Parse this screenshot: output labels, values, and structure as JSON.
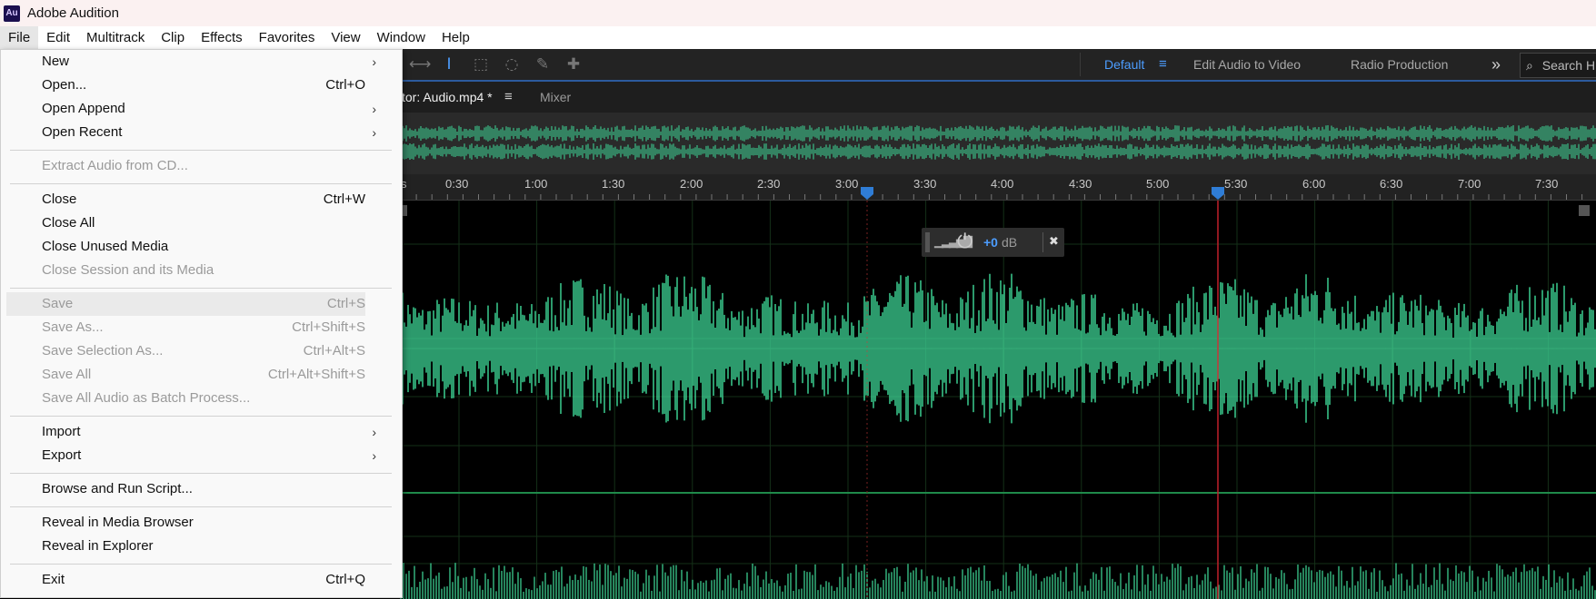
{
  "app": {
    "title": "Adobe Audition",
    "icon_text": "Au"
  },
  "menubar": [
    "File",
    "Edit",
    "Multitrack",
    "Clip",
    "Effects",
    "Favorites",
    "View",
    "Window",
    "Help"
  ],
  "workspaces": {
    "default": "Default",
    "edit_audio_video": "Edit Audio to Video",
    "radio": "Radio Production",
    "more": "»",
    "search_placeholder": "Search H"
  },
  "tabs": {
    "editor": "tor: Audio.mp4 *",
    "mixer": "Mixer"
  },
  "ruler": {
    "labels": [
      "s",
      "0:30",
      "1:00",
      "1:30",
      "2:00",
      "2:30",
      "3:00",
      "3:30",
      "4:00",
      "4:30",
      "5:00",
      "5:30",
      "6:00",
      "6:30",
      "7:00",
      "7:30"
    ]
  },
  "hud": {
    "value": "+0",
    "unit": "dB"
  },
  "file_menu": {
    "new": {
      "label": "New",
      "arrow": "›"
    },
    "open": {
      "label": "Open...",
      "shortcut": "Ctrl+O"
    },
    "open_append": {
      "label": "Open Append",
      "arrow": "›"
    },
    "open_recent": {
      "label": "Open Recent",
      "arrow": "›"
    },
    "extract_cd": {
      "label": "Extract Audio from CD..."
    },
    "close": {
      "label": "Close",
      "shortcut": "Ctrl+W"
    },
    "close_all": {
      "label": "Close All"
    },
    "close_unused": {
      "label": "Close Unused Media"
    },
    "close_session": {
      "label": "Close Session and its Media"
    },
    "save": {
      "label": "Save",
      "shortcut": "Ctrl+S"
    },
    "save_as": {
      "label": "Save As...",
      "shortcut": "Ctrl+Shift+S"
    },
    "save_selection": {
      "label": "Save Selection As...",
      "shortcut": "Ctrl+Alt+S"
    },
    "save_all": {
      "label": "Save All",
      "shortcut": "Ctrl+Alt+Shift+S"
    },
    "save_batch": {
      "label": "Save All Audio as Batch Process..."
    },
    "import": {
      "label": "Import",
      "arrow": "›"
    },
    "export": {
      "label": "Export",
      "arrow": "›"
    },
    "browse_script": {
      "label": "Browse and Run Script..."
    },
    "reveal_media": {
      "label": "Reveal in Media Browser"
    },
    "reveal_explorer": {
      "label": "Reveal in Explorer"
    },
    "exit": {
      "label": "Exit",
      "shortcut": "Ctrl+Q"
    }
  },
  "colors": {
    "waveform": "#3fdc9b",
    "accent": "#4c9dff",
    "playhead": "#c0202a",
    "menu_bg": "#f9f9f9"
  }
}
